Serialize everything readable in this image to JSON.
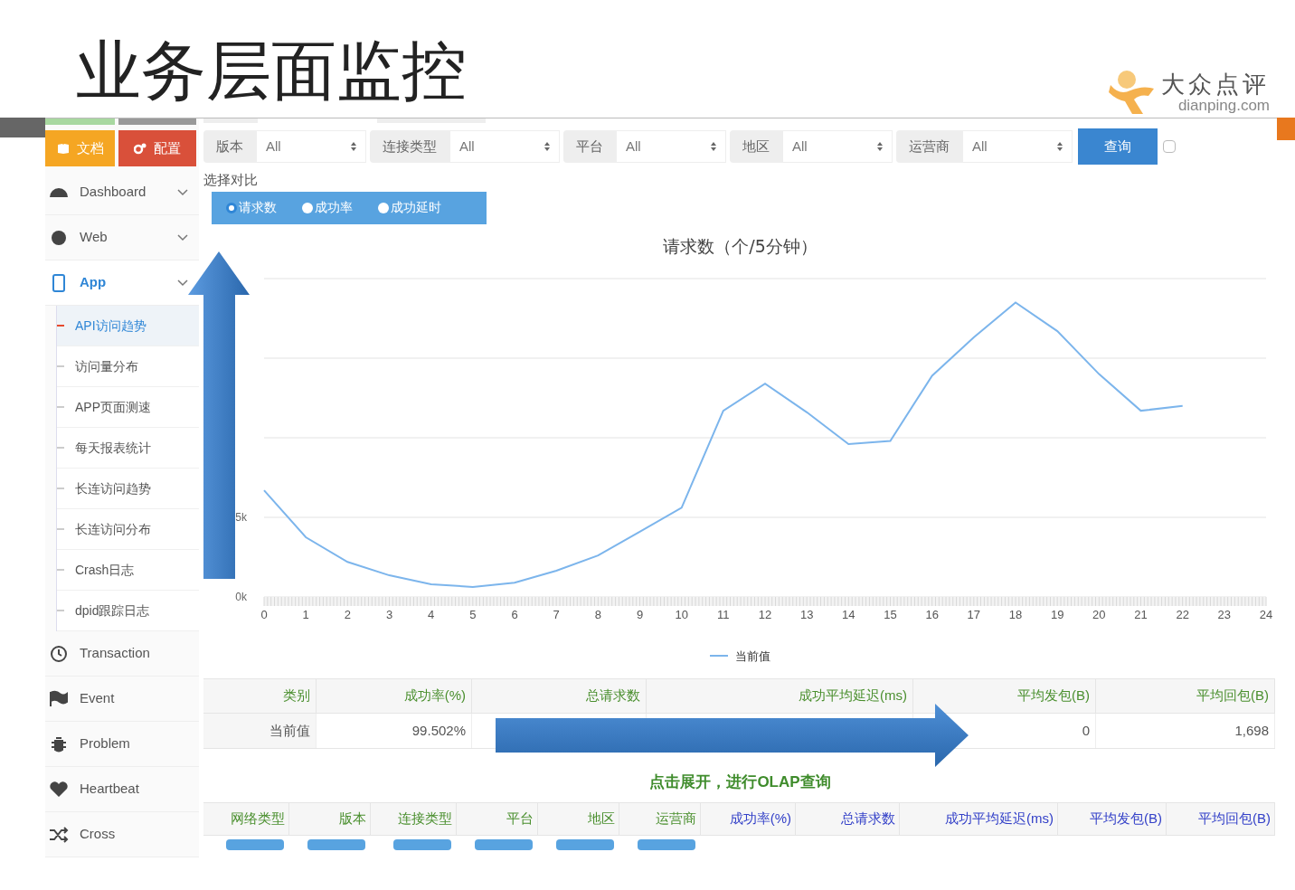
{
  "slide": {
    "title": "业务层面监控",
    "logo_name": "大众点评",
    "logo_url": "dianping.com"
  },
  "sidebar": {
    "buttons": [
      {
        "label": "文档",
        "kind": "docs"
      },
      {
        "label": "配置",
        "kind": "config"
      }
    ],
    "items": [
      {
        "label": "Dashboard",
        "kind": "gauge",
        "chevron": true,
        "selected": false
      },
      {
        "label": "Web",
        "kind": "globe",
        "chevron": true,
        "selected": false
      },
      {
        "label": "App",
        "kind": "phone",
        "chevron": true,
        "selected": true,
        "children": [
          {
            "label": "API访问趋势",
            "selected": true
          },
          {
            "label": "访问量分布",
            "selected": false
          },
          {
            "label": "APP页面测速",
            "selected": false
          },
          {
            "label": "每天报表统计",
            "selected": false
          },
          {
            "label": "长连访问趋势",
            "selected": false
          },
          {
            "label": "长连访问分布",
            "selected": false
          },
          {
            "label": "Crash日志",
            "selected": false
          },
          {
            "label": "dpid跟踪日志",
            "selected": false
          }
        ]
      },
      {
        "label": "Transaction",
        "kind": "clock",
        "chevron": false,
        "selected": false
      },
      {
        "label": "Event",
        "kind": "flag",
        "chevron": false,
        "selected": false
      },
      {
        "label": "Problem",
        "kind": "bug",
        "chevron": false,
        "selected": false
      },
      {
        "label": "Heartbeat",
        "kind": "heart",
        "chevron": false,
        "selected": false
      },
      {
        "label": "Cross",
        "kind": "shuffle",
        "chevron": false,
        "selected": false
      }
    ]
  },
  "filters": [
    {
      "label": "版本",
      "value": "All"
    },
    {
      "label": "连接类型",
      "value": "All"
    },
    {
      "label": "平台",
      "value": "All"
    },
    {
      "label": "地区",
      "value": "All"
    },
    {
      "label": "运营商",
      "value": "All"
    }
  ],
  "query_button": "查询",
  "compare_checkbox": {
    "checked": false
  },
  "compare": {
    "label": "选择对比",
    "options": [
      {
        "label": "请求数",
        "selected": true
      },
      {
        "label": "成功率",
        "selected": false
      },
      {
        "label": "成功延时",
        "selected": false
      }
    ]
  },
  "chart_data": {
    "type": "line",
    "title": "请求数（个/5分钟）",
    "x": [
      0,
      1,
      2,
      3,
      4,
      5,
      6,
      7,
      8,
      9,
      10,
      11,
      12,
      13,
      14,
      15,
      16,
      17,
      18,
      19,
      20,
      21,
      22
    ],
    "series": [
      {
        "name": "当前值",
        "color": "#7cb5ec",
        "values": [
          6700,
          3750,
          2200,
          1360,
          800,
          630,
          900,
          1650,
          2600,
          4100,
          5600,
          11700,
          13400,
          11600,
          9600,
          9800,
          13900,
          16300,
          18500,
          16700,
          14000,
          11700,
          12000
        ]
      }
    ],
    "xlim": [
      0,
      24
    ],
    "ylim": [
      0,
      20000
    ],
    "xticks": [
      0,
      1,
      2,
      3,
      4,
      5,
      6,
      7,
      8,
      9,
      10,
      11,
      12,
      13,
      14,
      15,
      16,
      17,
      18,
      19,
      20,
      21,
      22,
      23,
      24
    ],
    "grid": true,
    "yticks": [
      {
        "value": 0,
        "label": "0k"
      },
      {
        "value": 5000,
        "label": "5k"
      }
    ]
  },
  "summary_table": {
    "columns": [
      "类别",
      "成功率(%)",
      "总请求数",
      "成功平均延迟(ms)",
      "平均发包(B)",
      "平均回包(B)"
    ],
    "rows": [
      [
        "当前值",
        "99.502%",
        null,
        null,
        "0",
        "1,698"
      ]
    ]
  },
  "olap_hint": "点击展开，进行OLAP查询",
  "detail_table": {
    "columns": [
      {
        "label": "网络类型",
        "kind": "dimension"
      },
      {
        "label": "版本",
        "kind": "dimension"
      },
      {
        "label": "连接类型",
        "kind": "dimension"
      },
      {
        "label": "平台",
        "kind": "dimension"
      },
      {
        "label": "地区",
        "kind": "dimension"
      },
      {
        "label": "运营商",
        "kind": "dimension"
      },
      {
        "label": "成功率(%)",
        "kind": "metric"
      },
      {
        "label": "总请求数",
        "kind": "metric"
      },
      {
        "label": "成功平均延迟(ms)",
        "kind": "metric"
      },
      {
        "label": "平均发包(B)",
        "kind": "metric"
      },
      {
        "label": "平均回包(B)",
        "kind": "metric"
      }
    ]
  }
}
